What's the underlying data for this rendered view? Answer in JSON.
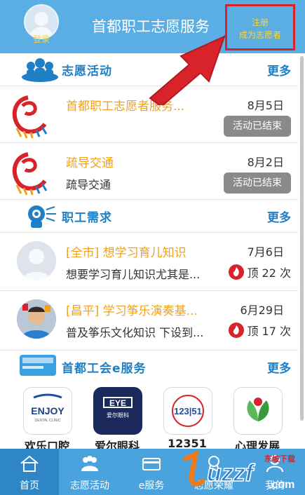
{
  "header": {
    "login_label": "登录",
    "title": "首都职工志愿服务",
    "register_line1": "注册",
    "register_line2": "成为志愿者"
  },
  "sections": {
    "volunteer": {
      "title": "志愿活动",
      "more": "更多"
    },
    "needs": {
      "title": "职工需求",
      "more": "更多"
    },
    "eservice": {
      "title": "首都工会e服务",
      "more": "更多"
    }
  },
  "activities": [
    {
      "title": "首都职工志愿者服务...",
      "sub": "",
      "date": "8月5日",
      "status": "活动已结束"
    },
    {
      "title": "疏导交通",
      "sub": "疏导交通",
      "date": "8月2日",
      "status": "活动已结束"
    }
  ],
  "needs": [
    {
      "title": "[全市] 想学习育儿知识",
      "sub": "想要学习育儿知识尤其是...",
      "date": "7月6日",
      "votes": "顶 22 次"
    },
    {
      "title": "[昌平] 学习筝乐演奏基...",
      "sub": "普及筝乐文化知识 下设到...",
      "date": "6月29日",
      "votes": "顶 17 次"
    }
  ],
  "tiles": [
    {
      "label": "欢乐口腔",
      "logo": "ENJOY",
      "logo_sub": "DENTAL CLINIC"
    },
    {
      "label": "爱尔眼科",
      "logo": "EYE",
      "logo_sub": "爱尔眼科"
    },
    {
      "label": "12351",
      "logo": "123|51"
    },
    {
      "label": "心理发展",
      "logo": ""
    }
  ],
  "tabs": [
    {
      "label": "首页",
      "icon": "home-icon"
    },
    {
      "label": "志愿活动",
      "icon": "volunteer-icon"
    },
    {
      "label": "e服务",
      "icon": "card-icon"
    },
    {
      "label": "志愿荣耀",
      "icon": "honor-icon"
    },
    {
      "label": "我的",
      "icon": "profile-icon"
    }
  ],
  "watermark": {
    "brand": "uzzf",
    "sub": "东坡下载",
    "domain": ".com"
  },
  "colors": {
    "header": "#5aaee3",
    "accent": "#1f7fc4",
    "title_orange": "#f0a21c",
    "register_text": "#f6d548",
    "highlight_box": "#d8232a",
    "tabbar": "#4ba3de"
  }
}
